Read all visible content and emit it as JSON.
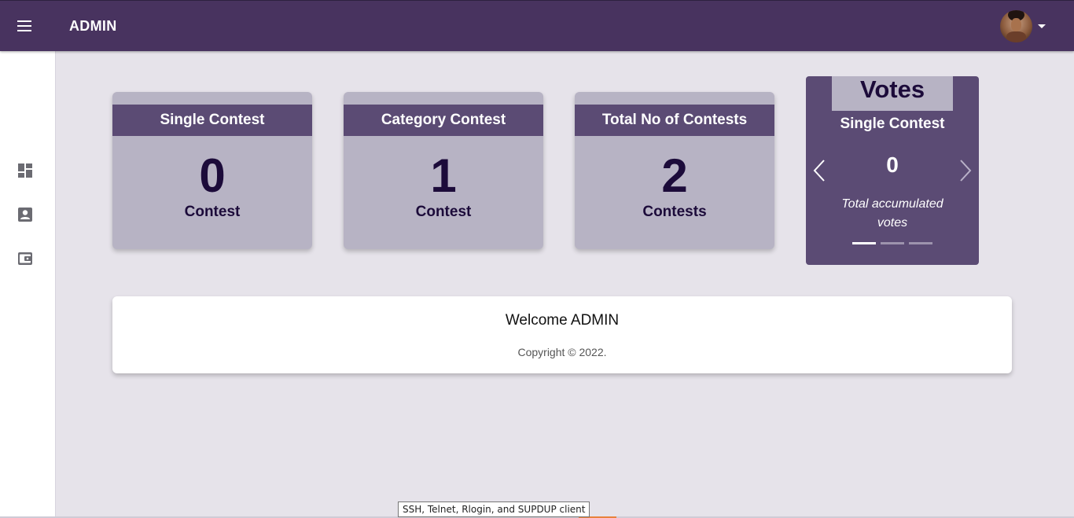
{
  "topbar": {
    "brand": "ADMIN",
    "menu_icon": "hamburger-icon",
    "avatar_icon": "user-avatar",
    "dropdown_icon": "caret-down-icon",
    "background": "#48335f"
  },
  "sidebar": {
    "items": [
      {
        "icon": "dashboard-icon"
      },
      {
        "icon": "account-box-icon"
      },
      {
        "icon": "wallet-icon"
      }
    ]
  },
  "stats": [
    {
      "title": "Single Contest",
      "value": "0",
      "unit": "Contest"
    },
    {
      "title": "Category Contest",
      "value": "1",
      "unit": "Contest"
    },
    {
      "title": "Total No of Contests",
      "value": "2",
      "unit": "Contests"
    }
  ],
  "votes": {
    "title": "Votes",
    "label": "Single Contest",
    "value": "0",
    "description": "Total accumulated votes",
    "slides": 3,
    "active_slide": 1,
    "prev_icon": "chevron-left-icon",
    "next_icon": "chevron-right-icon"
  },
  "welcome": {
    "title": "Welcome ADMIN",
    "copyright": "Copyright © 2022."
  },
  "tooltip": {
    "text": "SSH, Telnet, Rlogin, and SUPDUP client"
  },
  "colors": {
    "header": "#48335f",
    "card_header": "#5b4b74",
    "card_body": "#b7b3c4",
    "number": "#1c0b3a",
    "page_bg": "#e6e3ea"
  }
}
